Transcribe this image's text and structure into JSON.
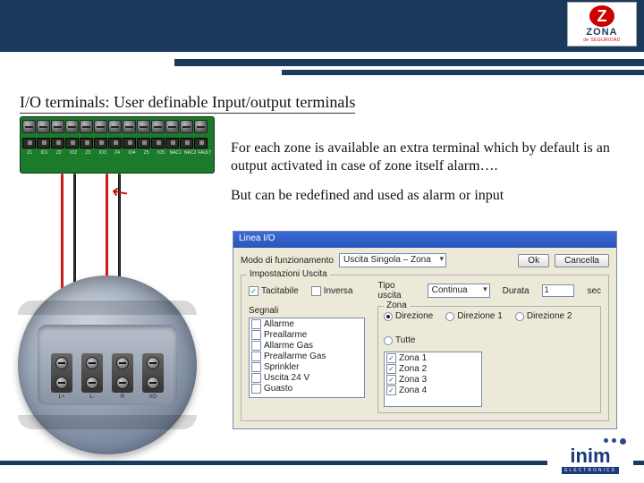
{
  "branding": {
    "zona_text": "ZONA",
    "zona_sub": "de SEGURIDAD",
    "zona_z": "Z",
    "inim_text": "inim",
    "inim_sub": "ELECTRONICS"
  },
  "title": "I/O terminals: User definable Input/output  terminals",
  "body": {
    "p1": "For each zone is available an extra terminal which by default is an output activated in case of zone itself alarm….",
    "p2": "But can be redefined and used as alarm or input"
  },
  "board": {
    "labels": [
      "Z1",
      "IO1",
      "Z2",
      "IO2",
      "Z3",
      "IO3",
      "Z4",
      "IO4",
      "Z5",
      "IO5",
      "NAC1",
      "NAC2",
      "FAULT"
    ]
  },
  "detector": {
    "term_labels": [
      "L+",
      "L-",
      "R",
      "I/O"
    ]
  },
  "dialog": {
    "title": "Linea I/O",
    "mode_label": "Modo di funzionamento",
    "mode_value": "Uscita Singola – Zona",
    "btn_ok": "Ok",
    "btn_cancel": "Cancella",
    "output_group": "Impostazioni Uscita",
    "chk_tacitabile": "Tacitabile",
    "chk_inversa": "Inversa",
    "pulse_label": "Tipo uscita",
    "pulse_value": "Continua",
    "duration_label": "Durata",
    "duration_value": "1",
    "duration_unit": "sec",
    "signals_group": "Segnali",
    "signals": [
      "Allarme",
      "Preallarme",
      "Allarme Gas",
      "Preallarme Gas",
      "Sprinkler",
      "Uscita 24 V",
      "Guasto"
    ],
    "signals_checked": [
      false,
      false,
      false,
      false,
      false,
      false,
      false
    ],
    "zone_group": "Zona",
    "zone_radios": [
      "Direzione",
      "Direzione 1",
      "Direzione 2",
      "Tutte"
    ],
    "zone_checks": [
      "Zona 1",
      "Zona 2",
      "Zona 3",
      "Zona 4"
    ],
    "zone_checks_on": [
      true,
      true,
      true,
      true
    ]
  }
}
